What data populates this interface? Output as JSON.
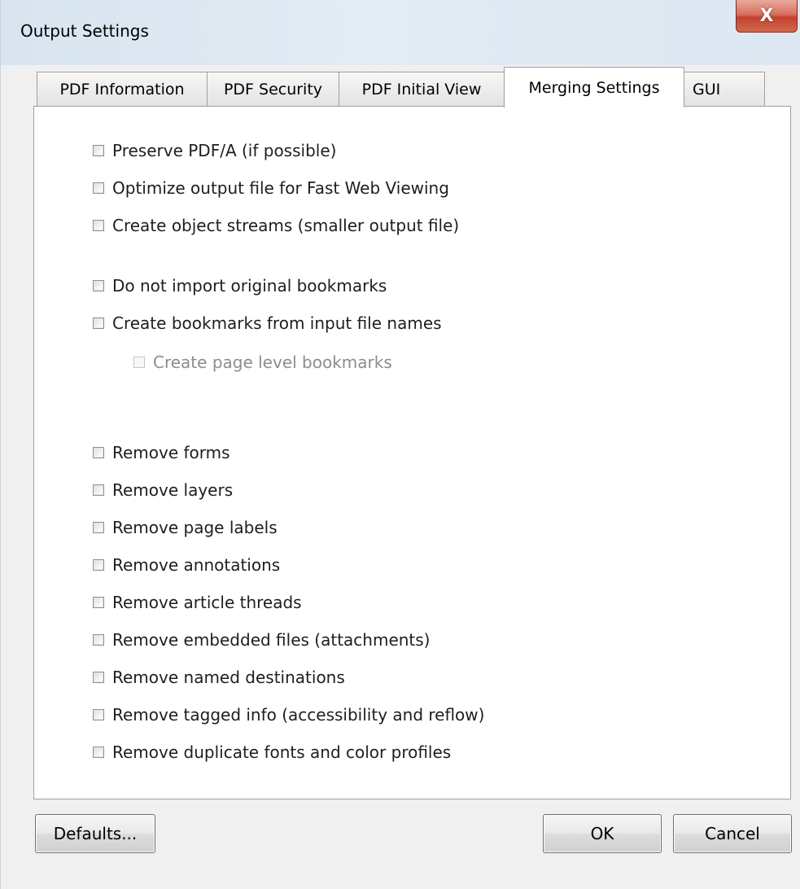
{
  "window": {
    "title": "Output Settings",
    "close_label": "X"
  },
  "tabs": [
    {
      "label": "PDF Information",
      "active": false
    },
    {
      "label": "PDF Security",
      "active": false
    },
    {
      "label": "PDF Initial View",
      "active": false
    },
    {
      "label": "Merging Settings",
      "active": true
    },
    {
      "label": "GUI",
      "active": false
    }
  ],
  "options": [
    {
      "label": "Preserve PDF/A (if possible)",
      "checked": false,
      "enabled": true
    },
    {
      "label": "Optimize output file for Fast Web Viewing",
      "checked": false,
      "enabled": true
    },
    {
      "label": "Create object streams (smaller output file)",
      "checked": false,
      "enabled": true
    },
    {
      "label": "Do not import original bookmarks",
      "checked": false,
      "enabled": true
    },
    {
      "label": "Create bookmarks from input file names",
      "checked": false,
      "enabled": true
    },
    {
      "label": "Create page level bookmarks",
      "checked": false,
      "enabled": false
    },
    {
      "label": "Remove forms",
      "checked": false,
      "enabled": true
    },
    {
      "label": "Remove layers",
      "checked": false,
      "enabled": true
    },
    {
      "label": "Remove page labels",
      "checked": false,
      "enabled": true
    },
    {
      "label": "Remove annotations",
      "checked": false,
      "enabled": true
    },
    {
      "label": "Remove article threads",
      "checked": false,
      "enabled": true
    },
    {
      "label": "Remove embedded files (attachments)",
      "checked": false,
      "enabled": true
    },
    {
      "label": "Remove named destinations",
      "checked": false,
      "enabled": true
    },
    {
      "label": "Remove tagged info (accessibility and reflow)",
      "checked": false,
      "enabled": true
    },
    {
      "label": "Remove duplicate fonts and color profiles",
      "checked": false,
      "enabled": true
    }
  ],
  "buttons": {
    "defaults": "Defaults...",
    "ok": "OK",
    "cancel": "Cancel"
  }
}
